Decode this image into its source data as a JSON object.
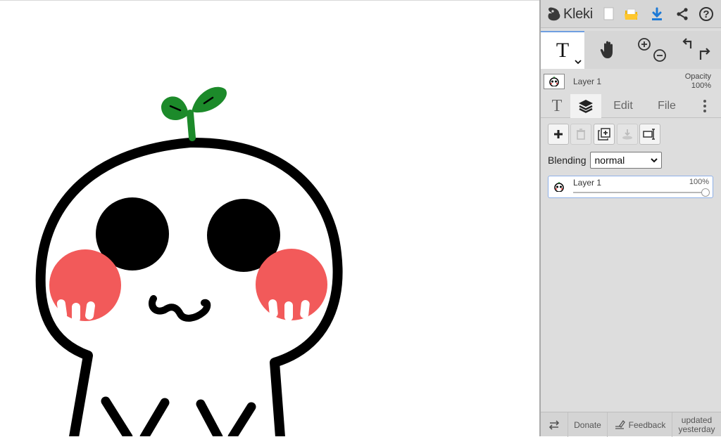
{
  "app": {
    "name": "Kleki"
  },
  "toolbar": {
    "buttons": [
      {
        "icon": "new-file-icon"
      },
      {
        "icon": "open-folder-icon"
      },
      {
        "icon": "download-icon"
      },
      {
        "icon": "share-icon"
      },
      {
        "icon": "help-icon",
        "glyph": "?"
      }
    ]
  },
  "tools": {
    "text_tool_glyph": "T",
    "hand_icon": "hand-icon",
    "zoom_in_icon": "zoom-in-icon",
    "zoom_out_icon": "zoom-out-icon",
    "undo_icon": "undo-icon",
    "redo_icon": "redo-icon"
  },
  "current_layer": {
    "name": "Layer 1",
    "opacity_label": "Opacity",
    "opacity_value": "100%"
  },
  "tabs": {
    "text_glyph": "T",
    "layers_icon": "layers-icon",
    "edit": "Edit",
    "file": "File",
    "more_icon": "more-vertical-icon"
  },
  "layer_tools": [
    {
      "icon": "add-layer-icon",
      "enabled": true
    },
    {
      "icon": "delete-layer-icon",
      "enabled": false
    },
    {
      "icon": "duplicate-layer-icon",
      "enabled": true
    },
    {
      "icon": "merge-down-icon",
      "enabled": false
    },
    {
      "icon": "rename-layer-icon",
      "enabled": true
    }
  ],
  "blending": {
    "label": "Blending",
    "value": "normal",
    "arrow": "⌄"
  },
  "layers": [
    {
      "name": "Layer 1",
      "opacity": "100%",
      "opacity_fraction": 1.0
    }
  ],
  "footer": {
    "swap_icon": "swap-icon",
    "donate": "Donate",
    "feedback_icon": "feedback-icon",
    "feedback": "Feedback",
    "updated_line1": "updated",
    "updated_line2": "yesterday"
  },
  "colors": {
    "accent": "#1e7ad6",
    "sprout_green": "#1c8a2a",
    "blush": "#f25a5a",
    "sidebar_bg": "#dddddd"
  }
}
